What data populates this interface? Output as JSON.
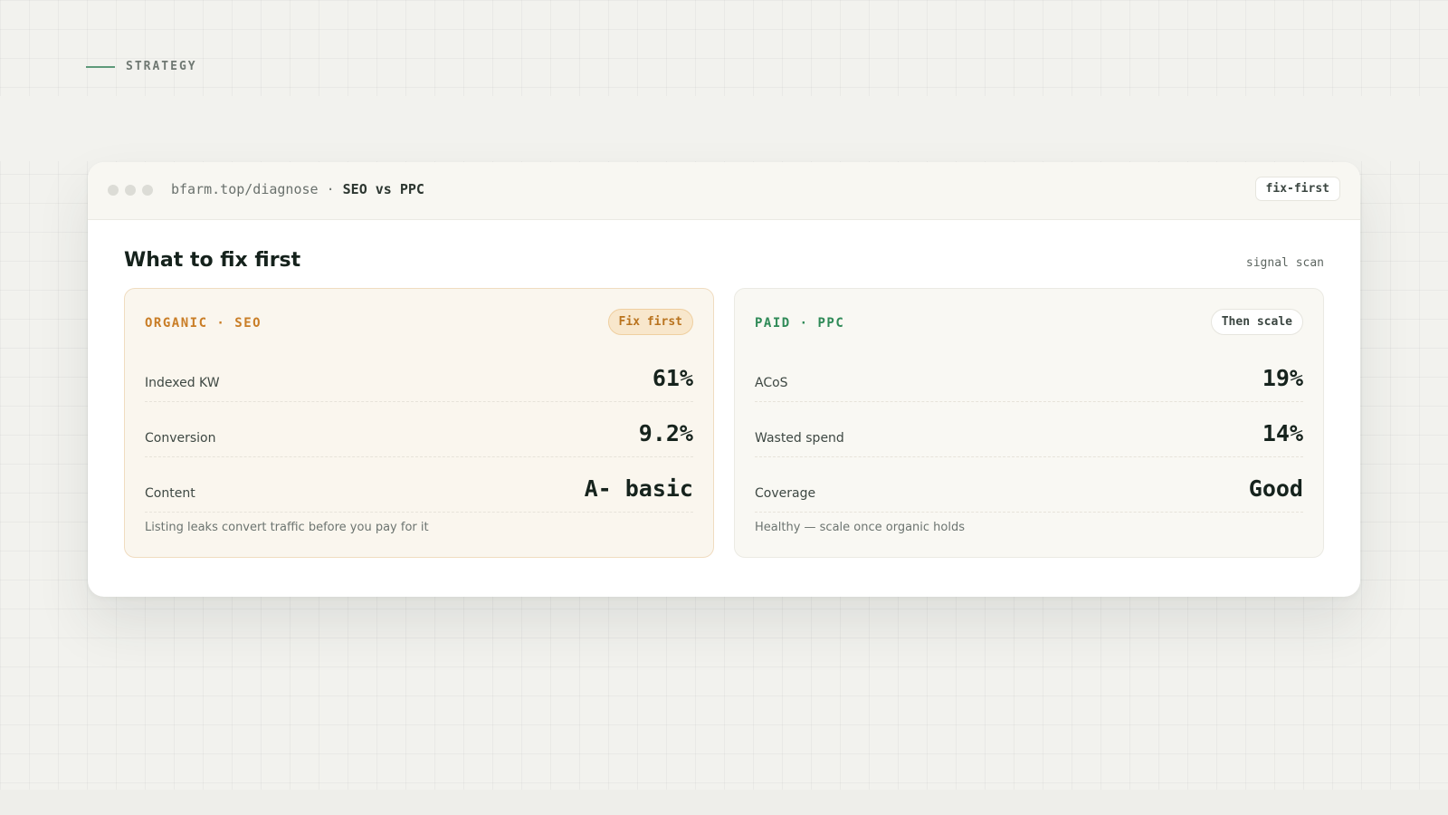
{
  "section": {
    "label": "STRATEGY"
  },
  "window": {
    "url_prefix": "bfarm.top/diagnose · ",
    "url_title": "SEO vs PPC",
    "chip": "fix-first"
  },
  "panel": {
    "heading": "What to fix first",
    "scan_label": "signal scan"
  },
  "cards": [
    {
      "title": "ORGANIC · SEO",
      "badge": "Fix first",
      "metrics": [
        {
          "label": "Indexed KW",
          "value": "61%"
        },
        {
          "label": "Conversion",
          "value": "9.2%"
        },
        {
          "label": "Content",
          "value": "A- basic"
        }
      ],
      "note": "Listing leaks convert traffic before you pay for it"
    },
    {
      "title": "PAID · PPC",
      "badge": "Then scale",
      "metrics": [
        {
          "label": "ACoS",
          "value": "19%"
        },
        {
          "label": "Wasted spend",
          "value": "14%"
        },
        {
          "label": "Coverage",
          "value": "Good"
        }
      ],
      "note": "Healthy — scale once organic holds"
    }
  ],
  "colors": {
    "accent_green": "#5e9a7a",
    "organic_orange": "#c97d26",
    "paid_green": "#2f8a57"
  }
}
